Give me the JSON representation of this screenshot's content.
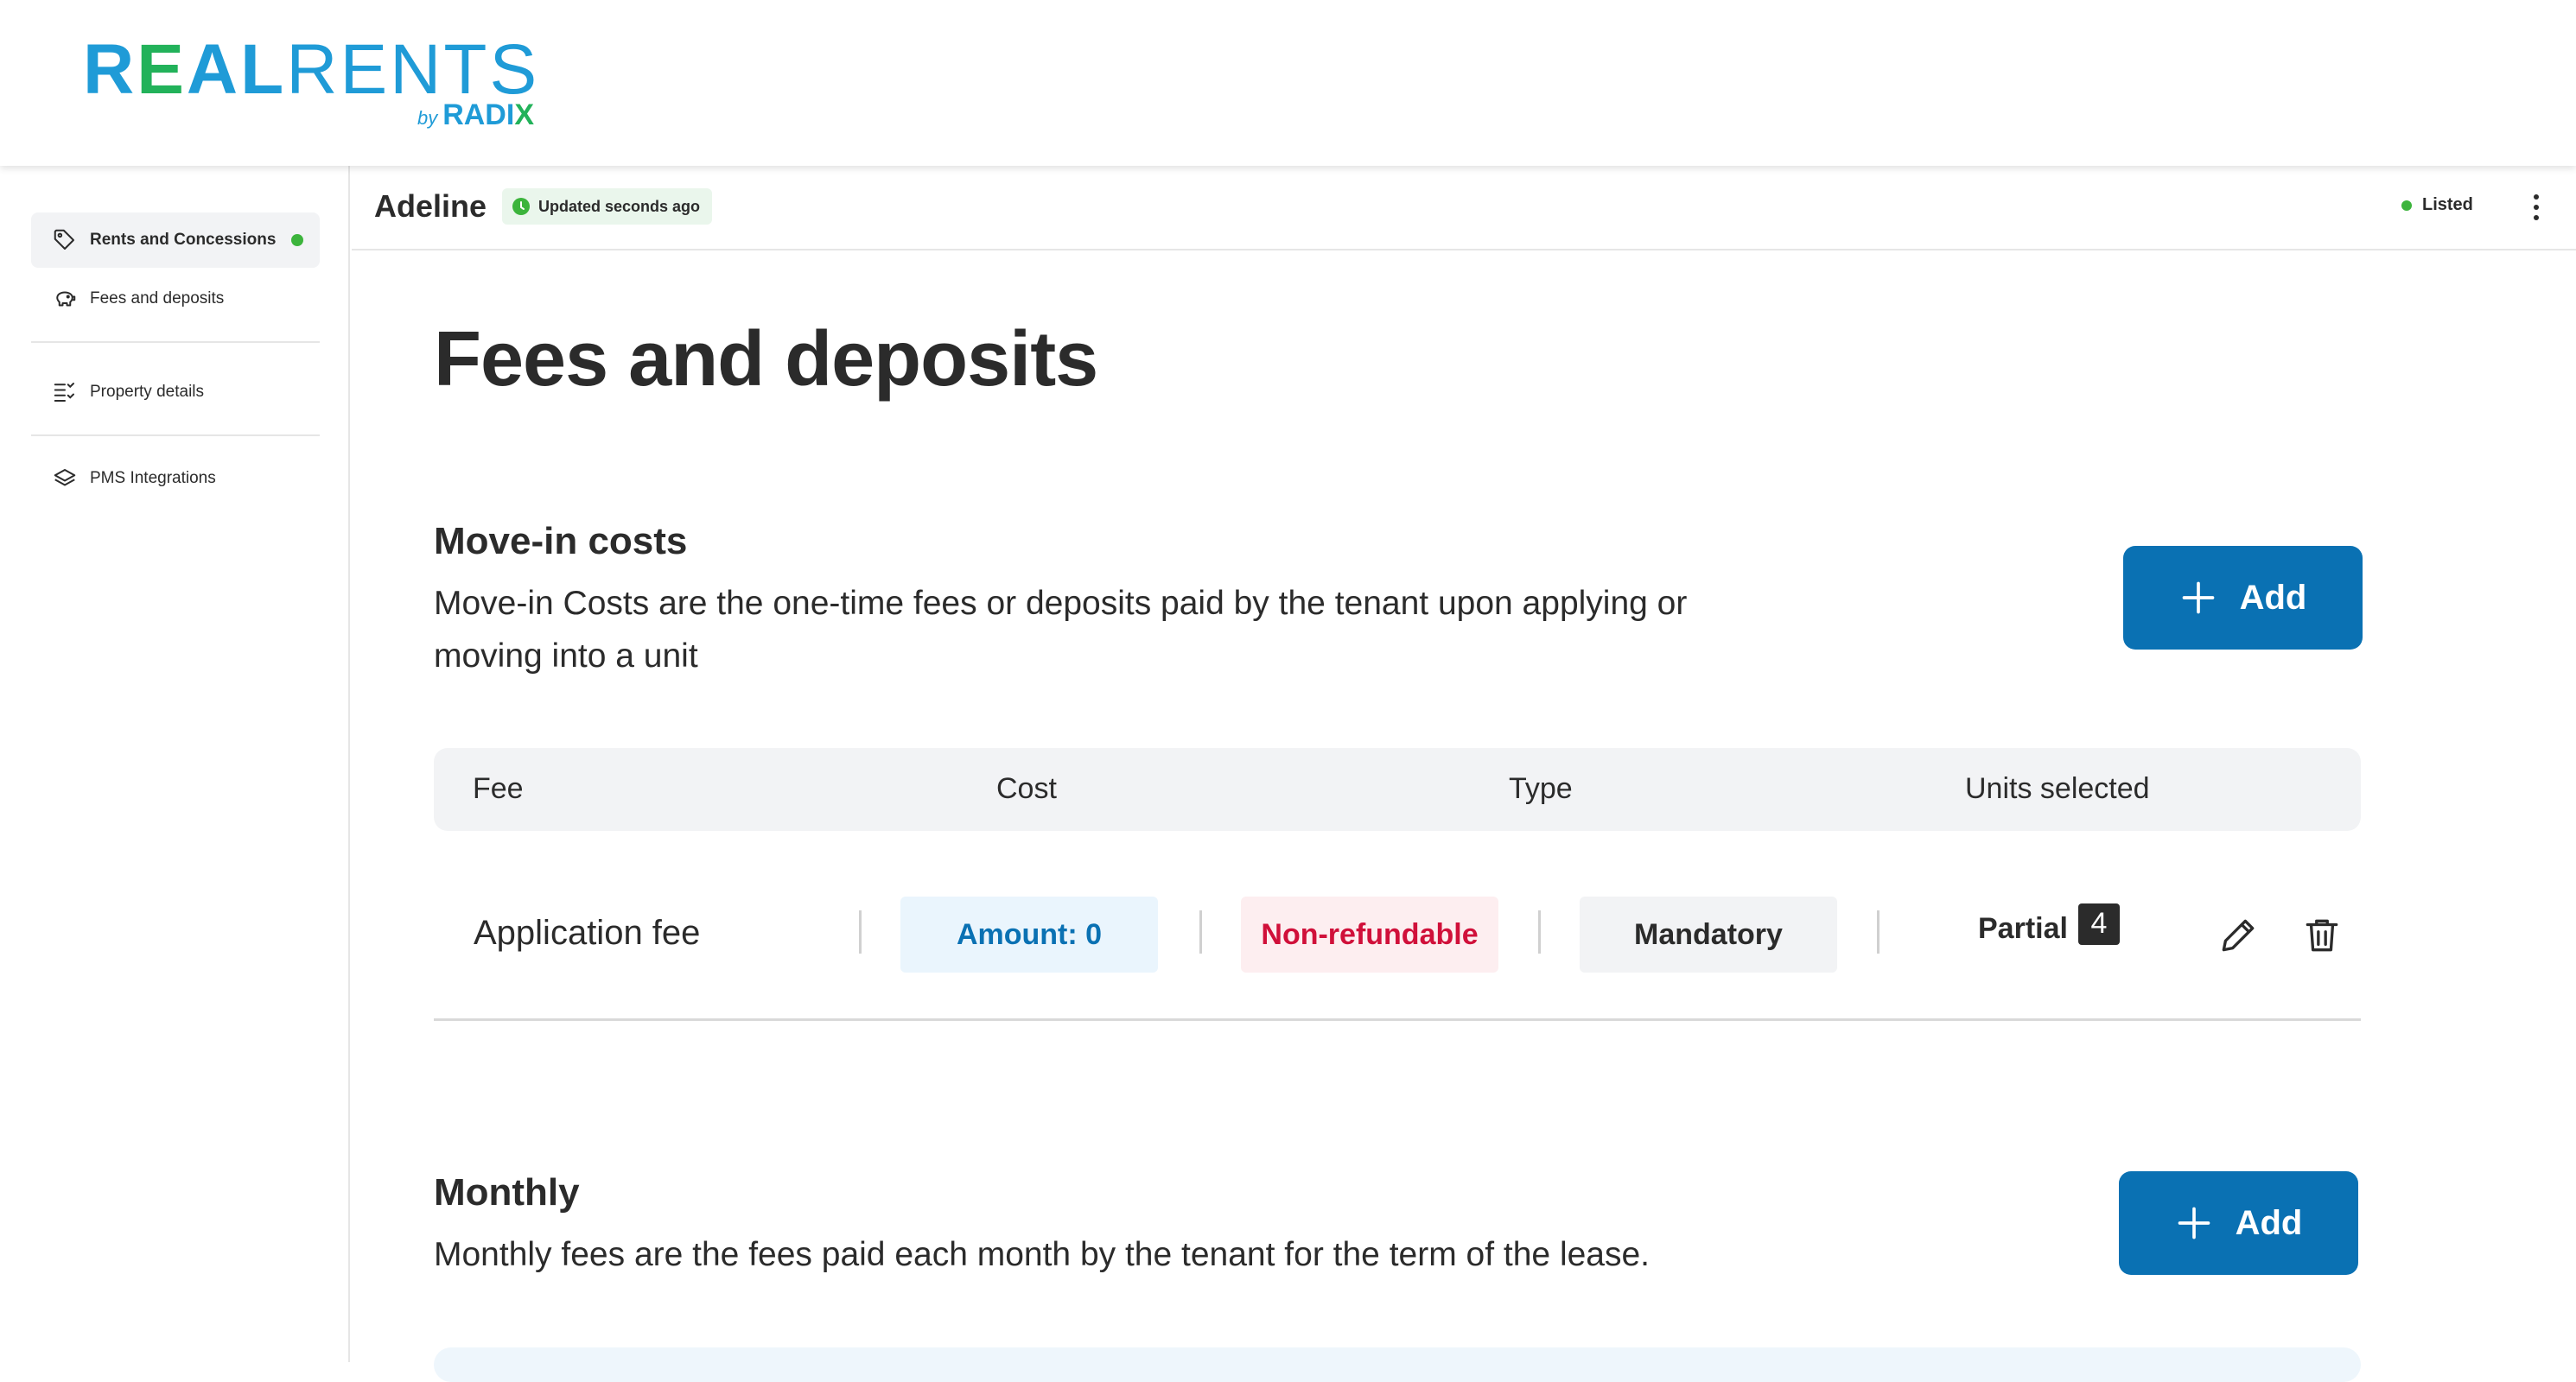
{
  "brand": {
    "logo_real_r": "R",
    "logo_real_e": "E",
    "logo_real_al": "AL",
    "logo_rents": "RENTS",
    "logo_by": "by",
    "logo_radi": "RADI",
    "logo_x": "X",
    "colors": {
      "blue": "#1f9bd7",
      "green": "#22b25a"
    }
  },
  "sidebar": {
    "items": [
      {
        "label": "Rents and Concessions",
        "icon": "tag-icon",
        "active": true,
        "status": "complete"
      },
      {
        "label": "Fees and deposits",
        "icon": "piggy-bank-icon",
        "active": false
      },
      {
        "label": "Property details",
        "icon": "checklist-icon",
        "active": false
      },
      {
        "label": "PMS Integrations",
        "icon": "layers-icon",
        "active": false
      }
    ]
  },
  "header": {
    "property_name": "Adeline",
    "updated_text": "Updated seconds ago",
    "status_text": "Listed",
    "status_color": "#3cb43c"
  },
  "page": {
    "title": "Fees and deposits"
  },
  "move_in": {
    "title": "Move-in costs",
    "description": "Move-in Costs are the one-time fees or deposits paid by the tenant upon applying or moving into a unit",
    "add_label": "Add",
    "columns": [
      "Fee",
      "Cost",
      "Type",
      "Units selected"
    ],
    "rows": [
      {
        "fee": "Application fee",
        "amount": "Amount: 0",
        "refund": "Non-refundable",
        "type": "Mandatory",
        "units": "Partial",
        "units_count": "4"
      }
    ]
  },
  "monthly": {
    "title": "Monthly",
    "description": "Monthly fees are the fees paid each month by the tenant for the term of the lease.",
    "add_label": "Add"
  },
  "theme": {
    "primary": "#0a71b3",
    "danger": "#d0103a",
    "success": "#3cb43c"
  }
}
